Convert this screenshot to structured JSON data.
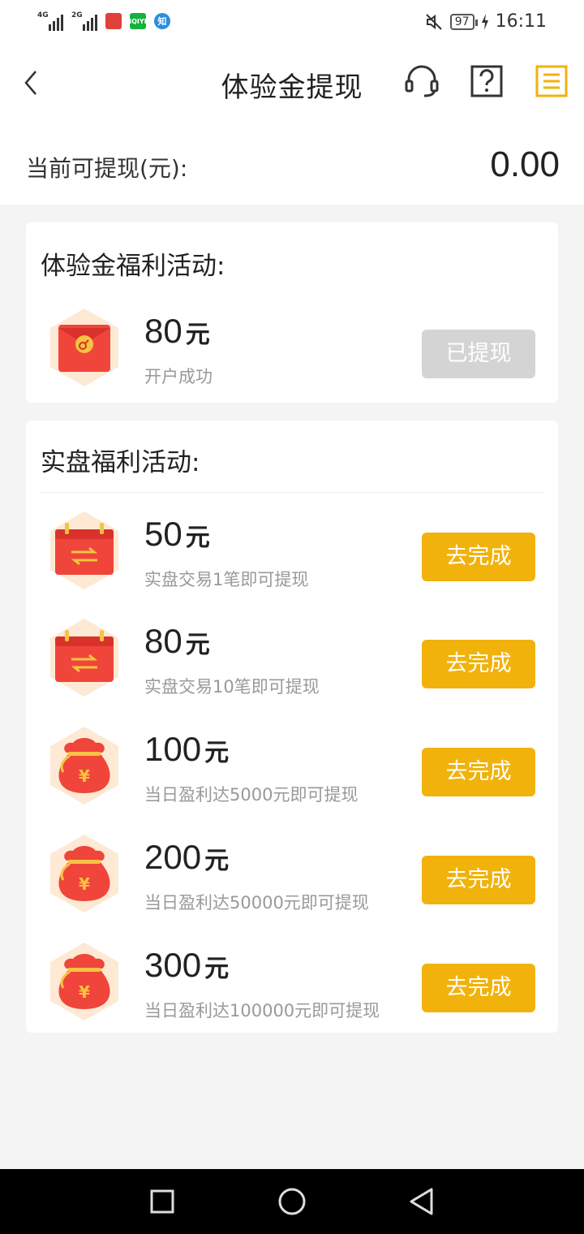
{
  "status_bar": {
    "networks": [
      "4G",
      "2G"
    ],
    "battery": "97",
    "time": "16:11",
    "apps": [
      {
        "name": "news-app",
        "color": "#e0403a",
        "text": ""
      },
      {
        "name": "iqiyi-app",
        "color": "#12b33c",
        "text": "iQIYI"
      },
      {
        "name": "zhihu-app",
        "color": "#2a8ee0",
        "text": "知"
      }
    ]
  },
  "nav": {
    "title": "体验金提现",
    "icons": [
      "back-icon",
      "headset-icon",
      "help-icon",
      "records-icon"
    ]
  },
  "balance": {
    "label": "当前可提现(元):",
    "value": "0.00"
  },
  "experience_card": {
    "title": "体验金福利活动:",
    "items": [
      {
        "amount": "80",
        "unit": "元",
        "desc": "开户成功",
        "button": "已提现",
        "icon": "red-envelope-icon"
      }
    ]
  },
  "real_card": {
    "title": "实盘福利活动:",
    "items": [
      {
        "amount": "50",
        "unit": "元",
        "desc": "实盘交易1笔即可提现",
        "button": "去完成",
        "icon": "exchange-calendar-icon"
      },
      {
        "amount": "80",
        "unit": "元",
        "desc": "实盘交易10笔即可提现",
        "button": "去完成",
        "icon": "exchange-calendar-icon"
      },
      {
        "amount": "100",
        "unit": "元",
        "desc": "当日盈利达5000元即可提现",
        "button": "去完成",
        "icon": "money-bag-icon"
      },
      {
        "amount": "200",
        "unit": "元",
        "desc": "当日盈利达50000元即可提现",
        "button": "去完成",
        "icon": "money-bag-icon"
      },
      {
        "amount": "300",
        "unit": "元",
        "desc": "当日盈利达100000元即可提现",
        "button": "去完成",
        "icon": "money-bag-icon"
      }
    ]
  },
  "colors": {
    "accent": "#f1b20c",
    "disabled": "#d4d4d4",
    "icon_red": "#f0453a"
  }
}
